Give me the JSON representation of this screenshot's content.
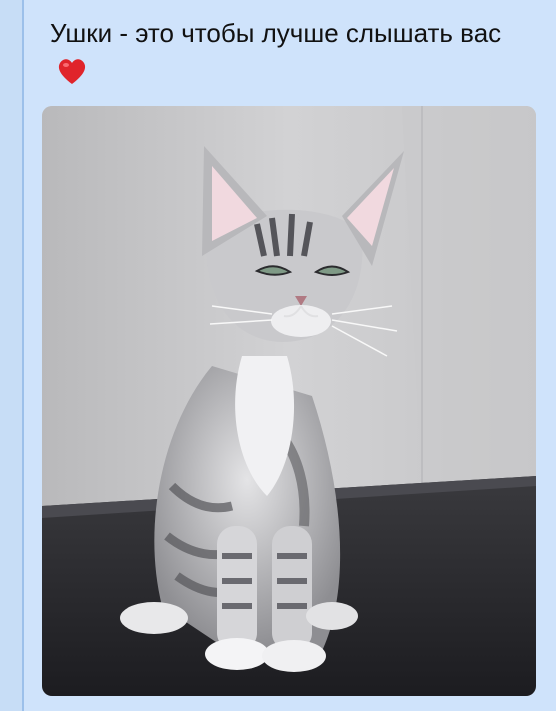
{
  "message": {
    "caption": "Ушки - это чтобы лучше слышать вас",
    "emoji": "heart-emoji",
    "emoji_color": "#e0242b"
  },
  "photo": {
    "subject": "kitten-photo"
  },
  "colors": {
    "background": "#c7ddf6",
    "bubble": "#cfe3fb",
    "rail": "#9cc0ea"
  }
}
